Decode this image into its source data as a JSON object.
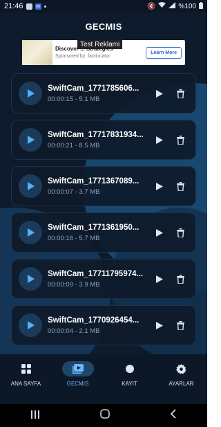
{
  "status_bar": {
    "time": "21:46",
    "battery": "%100"
  },
  "header": {
    "title": "GECMIS"
  },
  "ad": {
    "tag": "Test Reklami",
    "headline": "Discover ... Strategies",
    "sponsor": "Sponsored by: factlocator",
    "button": "Learn More"
  },
  "recordings": [
    {
      "name": "SwiftCam_1771785606...",
      "info": "00:00:15 - 5.1 MB"
    },
    {
      "name": "SwiftCam_17717831934...",
      "info": "00:00:21 - 8.5 MB"
    },
    {
      "name": "SwiftCam_1771367089...",
      "info": "00:00:07 - 3.7 MB"
    },
    {
      "name": "SwiftCam_1771361950...",
      "info": "00:00:16 - 5.7 MB"
    },
    {
      "name": "SwiftCam_17711795974...",
      "info": "00:00:09 - 3.9 MB"
    },
    {
      "name": "SwiftCam_1770926454...",
      "info": "00:00:04 - 2.1 MB"
    }
  ],
  "bottom_nav": [
    {
      "label": "ANA SAYFA",
      "icon": "grid-icon"
    },
    {
      "label": "GECMIS",
      "icon": "video-list-icon",
      "active": true
    },
    {
      "label": "KAYIT",
      "icon": "record-icon"
    },
    {
      "label": "AYARLAR",
      "icon": "gear-icon"
    }
  ],
  "colors": {
    "background": "#0e1b2c",
    "accent": "#6fb6ff",
    "play_icon": "#4fb2ff"
  }
}
